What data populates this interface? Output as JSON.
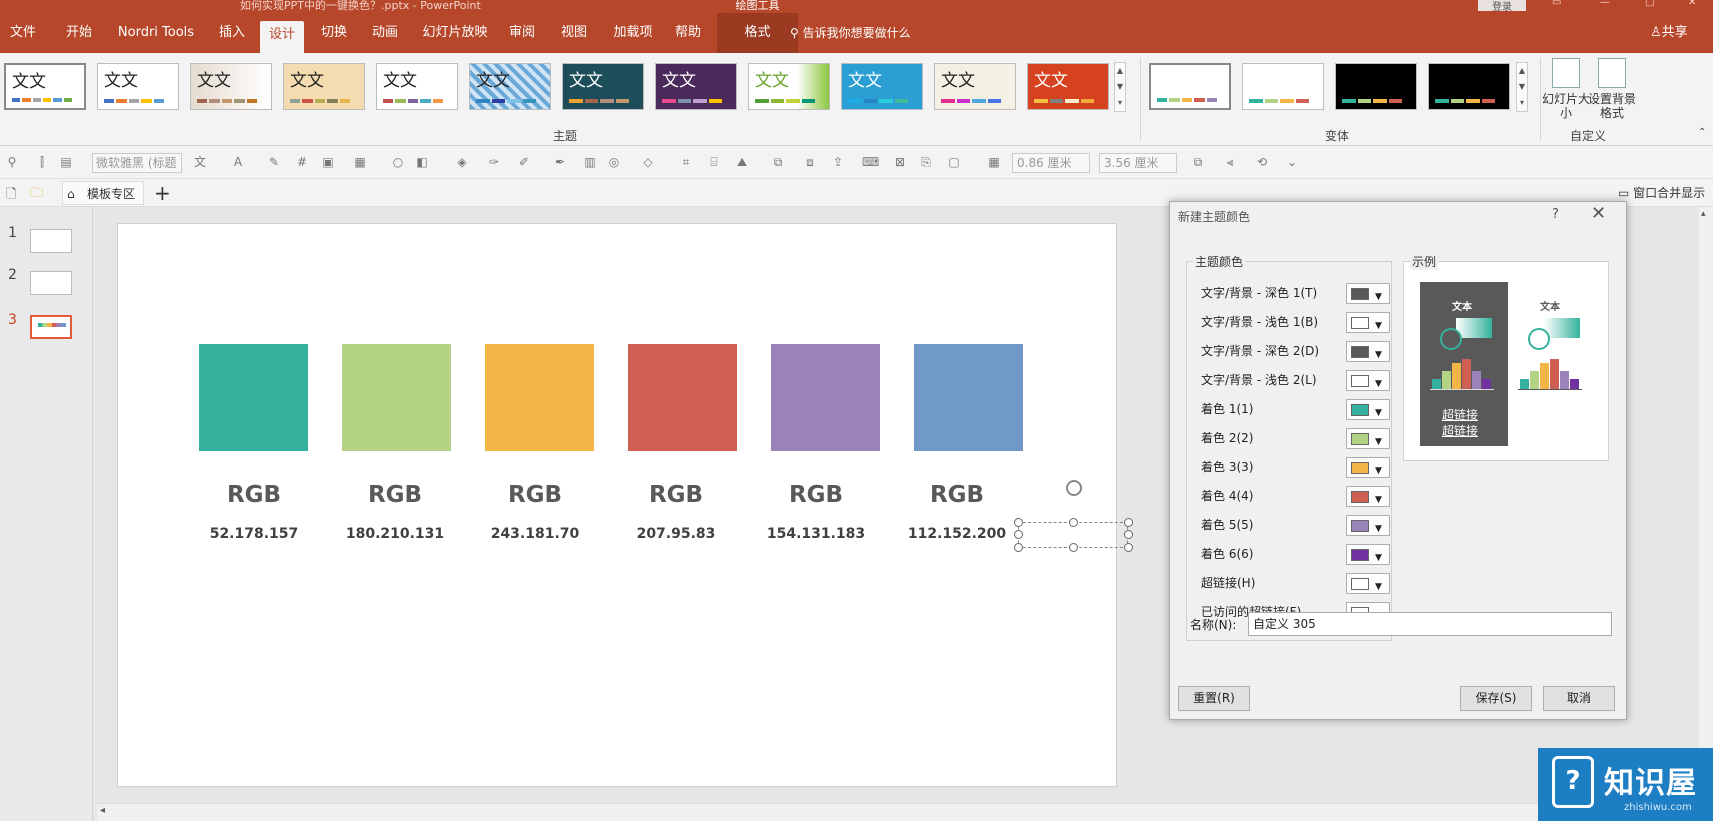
{
  "titlebar": {
    "title": "如何实现PPT中的一键换色？.pptx  -  PowerPoint",
    "context_group": "绘图工具",
    "login": "登录"
  },
  "tabs": [
    "文件",
    "开始",
    "Nordri Tools",
    "插入",
    "设计",
    "切换",
    "动画",
    "幻灯片放映",
    "审阅",
    "视图",
    "加载项",
    "帮助",
    "格式"
  ],
  "active_tab": "设计",
  "tell_me": "告诉我你想要做什么",
  "share": "共享",
  "ribbon": {
    "themes_label": "主题",
    "variants_label": "变体",
    "custom_label": "自定义",
    "theme_text": "文文",
    "slide_size_label": "幻灯片大小",
    "format_bg_label": "设置背景格式"
  },
  "drawbar": {
    "font_placeholder": "微软雅黑 (标题",
    "width_value": "0.86 厘米",
    "height_value": "3.56 厘米"
  },
  "docbar": {
    "template_tab": "模板专区",
    "merge_label": "窗口合并显示"
  },
  "slides": [
    "1",
    "2",
    "3"
  ],
  "slide": {
    "rgb_heading": "RGB",
    "swatches": [
      {
        "color": "#34B29D",
        "value": "52.178.157"
      },
      {
        "color": "#B4D283",
        "value": "180.210.131"
      },
      {
        "color": "#F3B546",
        "value": "243.181.70"
      },
      {
        "color": "#CF5F53",
        "value": "207.95.83"
      },
      {
        "color": "#9A83B7",
        "value": "154.131.183"
      },
      {
        "color": "#7098C8",
        "value": "112.152.200"
      }
    ]
  },
  "dialog": {
    "title": "新建主题颜色",
    "help": "?",
    "theme_colors_legend": "主题颜色",
    "sample_legend": "示例",
    "rows": [
      {
        "label": "文字/背景 - 深色 1(T)",
        "color": "#595959"
      },
      {
        "label": "文字/背景 - 浅色 1(B)",
        "color": "#FFFFFF"
      },
      {
        "label": "文字/背景 - 深色 2(D)",
        "color": "#595959"
      },
      {
        "label": "文字/背景 - 浅色 2(L)",
        "color": "#FFFFFF"
      },
      {
        "label": "着色 1(1)",
        "color": "#34B29D"
      },
      {
        "label": "着色 2(2)",
        "color": "#B4D283"
      },
      {
        "label": "着色 3(3)",
        "color": "#F3B546"
      },
      {
        "label": "着色 4(4)",
        "color": "#CF5F53"
      },
      {
        "label": "着色 5(5)",
        "color": "#9A83B7"
      },
      {
        "label": "着色 6(6)",
        "color": "#7030A0"
      },
      {
        "label": "超链接(H)",
        "color": "#FFFFFF"
      },
      {
        "label": "已访问的超链接(F)",
        "color": "#FFFFFF"
      }
    ],
    "sample_text": "文本",
    "sample_link": "超链接",
    "sample_visited": "超链接",
    "name_label": "名称(N):",
    "name_value": "自定义 305",
    "reset": "重置(R)",
    "save": "保存(S)",
    "cancel": "取消"
  },
  "logo": {
    "name": "知识屋",
    "domain": "zhishiwu.com"
  }
}
